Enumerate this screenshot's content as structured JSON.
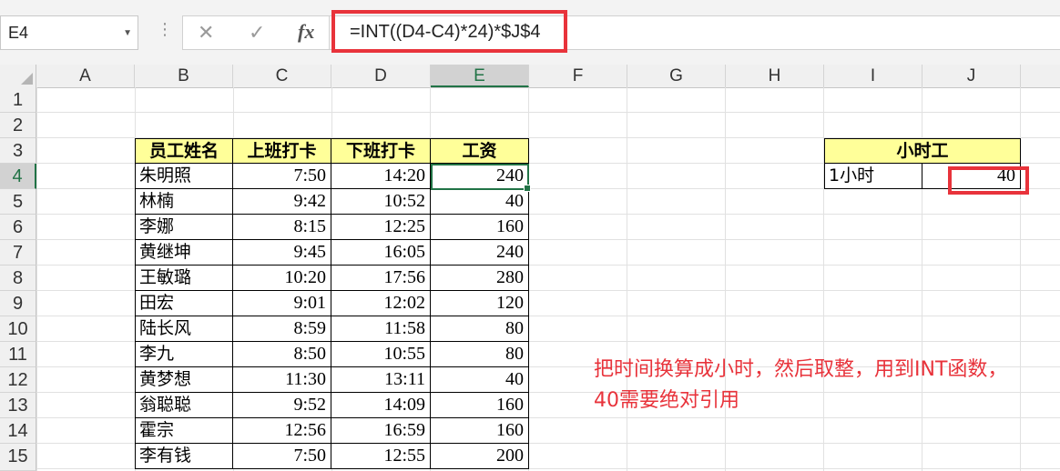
{
  "name_box": "E4",
  "formula": "=INT((D4-C4)*24)*$J$4",
  "formula_buttons": {
    "cancel": "✕",
    "enter": "✓",
    "fx": "fx"
  },
  "columns": [
    "A",
    "B",
    "C",
    "D",
    "E",
    "F",
    "G",
    "H",
    "I",
    "J"
  ],
  "rows": [
    "1",
    "2",
    "3",
    "4",
    "5",
    "6",
    "7",
    "8",
    "9",
    "10",
    "11",
    "12",
    "13",
    "14",
    "15"
  ],
  "table": {
    "headers": [
      "员工姓名",
      "上班打卡",
      "下班打卡",
      "工资"
    ],
    "rows": [
      [
        "朱明照",
        "7:50",
        "14:20",
        "240"
      ],
      [
        "林楠",
        "9:42",
        "10:52",
        "40"
      ],
      [
        "李娜",
        "8:15",
        "12:25",
        "160"
      ],
      [
        "黄继坤",
        "9:45",
        "16:05",
        "240"
      ],
      [
        "王敏璐",
        "10:20",
        "17:56",
        "280"
      ],
      [
        "田宏",
        "9:01",
        "12:02",
        "120"
      ],
      [
        "陆长风",
        "8:59",
        "11:58",
        "80"
      ],
      [
        "李九",
        "8:50",
        "10:55",
        "80"
      ],
      [
        "黄梦想",
        "11:30",
        "13:11",
        "40"
      ],
      [
        "翁聪聪",
        "9:52",
        "14:09",
        "160"
      ],
      [
        "霍宗",
        "12:56",
        "16:59",
        "160"
      ],
      [
        "李有钱",
        "7:50",
        "12:55",
        "200"
      ]
    ]
  },
  "rate_table": {
    "title": "小时工",
    "label": "1小时",
    "value": "40"
  },
  "annotation": {
    "line1": "把时间换算成小时，然后取整，用到INT函数，",
    "line2": "40需要绝对引用"
  },
  "colors": {
    "accent": "#217346",
    "highlight": "#e8333b",
    "header_fill": "#ffff99"
  }
}
